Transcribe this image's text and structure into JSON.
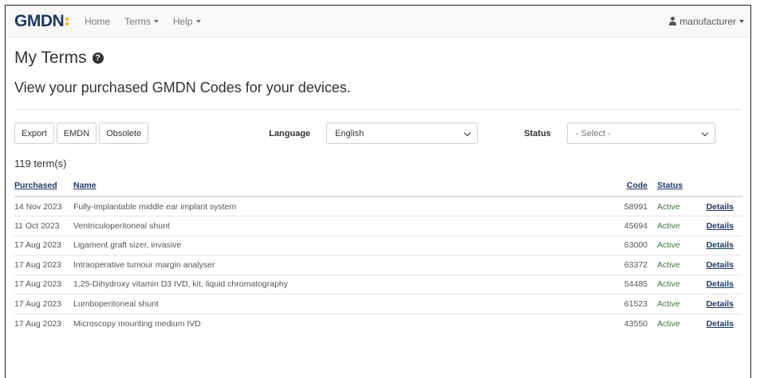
{
  "navbar": {
    "brand": "GMDN",
    "items": [
      {
        "label": "Home"
      },
      {
        "label": "Terms"
      },
      {
        "label": "Help"
      }
    ],
    "user": "manufacturer"
  },
  "page": {
    "title": "My Terms",
    "subtitle": "View your purchased GMDN Codes for your devices."
  },
  "toolbar": {
    "export_label": "Export",
    "emdn_label": "EMDN",
    "obsolete_label": "Obsolete",
    "language_label": "Language",
    "language_value": "English",
    "status_label": "Status",
    "status_value": "- Select -"
  },
  "count_text": "119 term(s)",
  "table": {
    "headers": {
      "purchased": "Purchased",
      "name": "Name",
      "code": "Code",
      "status": "Status"
    },
    "rows": [
      {
        "purchased": "14 Nov 2023",
        "name": "Fully-implantable middle ear implant system",
        "code": "58991",
        "status": "Active",
        "details": "Details"
      },
      {
        "purchased": "11 Oct 2023",
        "name": "Ventriculoperitoneal shunt",
        "code": "45694",
        "status": "Active",
        "details": "Details"
      },
      {
        "purchased": "17 Aug 2023",
        "name": "Ligament graft sizer, invasive",
        "code": "63000",
        "status": "Active",
        "details": "Details"
      },
      {
        "purchased": "17 Aug 2023",
        "name": "Intraoperative tumour margin analyser",
        "code": "63372",
        "status": "Active",
        "details": "Details"
      },
      {
        "purchased": "17 Aug 2023",
        "name": "1,25-Dihydroxy vitamin D3 IVD, kit, liquid chromatography",
        "code": "54485",
        "status": "Active",
        "details": "Details"
      },
      {
        "purchased": "17 Aug 2023",
        "name": "Lumboperitoneal shunt",
        "code": "61523",
        "status": "Active",
        "details": "Details"
      },
      {
        "purchased": "17 Aug 2023",
        "name": "Microscopy mounting medium IVD",
        "code": "43550",
        "status": "Active",
        "details": "Details"
      }
    ]
  },
  "colors": {
    "brand": "#1f3864",
    "accent": "#f2b705",
    "status_active": "#3c763d"
  }
}
